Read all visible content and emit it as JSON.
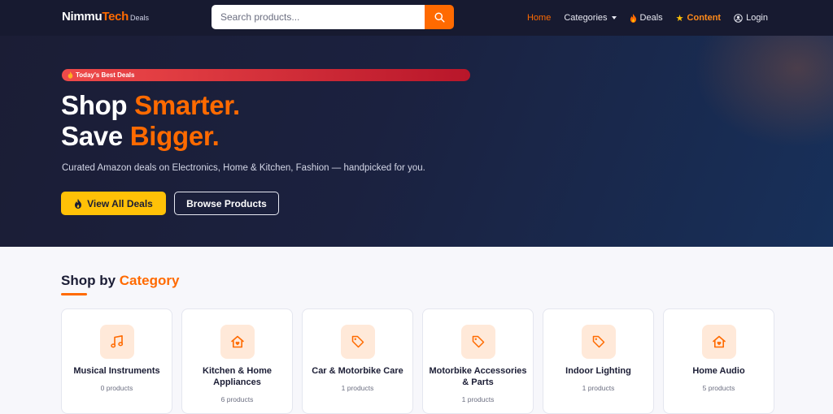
{
  "nav": {
    "brand_main": "Nimmu",
    "brand_accent": "Tech",
    "brand_small": "Deals",
    "search_placeholder": "Search products...",
    "links": {
      "home": "Home",
      "categories": "Categories",
      "deals": "Deals",
      "content": "Content",
      "login": "Login"
    }
  },
  "hero": {
    "badge": "Today's Best Deals",
    "line1_white": "Shop ",
    "line1_accent": "Smarter.",
    "line2_white": "Save ",
    "line2_accent": "Bigger.",
    "subtitle": "Curated Amazon deals on Electronics, Home & Kitchen, Fashion — handpicked for you.",
    "btn_deals": "View All Deals",
    "btn_browse": "Browse Products"
  },
  "categories": {
    "title_white": "Shop by ",
    "title_accent": "Category",
    "items": [
      {
        "name": "Musical Instruments",
        "count": "0 products",
        "icon": "music-note-icon"
      },
      {
        "name": "Kitchen & Home Appliances",
        "count": "6 products",
        "icon": "house-heart-icon"
      },
      {
        "name": "Car & Motorbike Care",
        "count": "1 products",
        "icon": "tag-icon"
      },
      {
        "name": "Motorbike Accessories & Parts",
        "count": "1 products",
        "icon": "tag-icon"
      },
      {
        "name": "Indoor Lighting",
        "count": "1 products",
        "icon": "tag-icon"
      },
      {
        "name": "Home Audio",
        "count": "5 products",
        "icon": "house-heart-icon"
      }
    ]
  },
  "colors": {
    "accent": "#ff6a00",
    "nav_bg": "#171a30",
    "cta_yellow": "#ffc107",
    "badge_red": "#e0313a"
  }
}
